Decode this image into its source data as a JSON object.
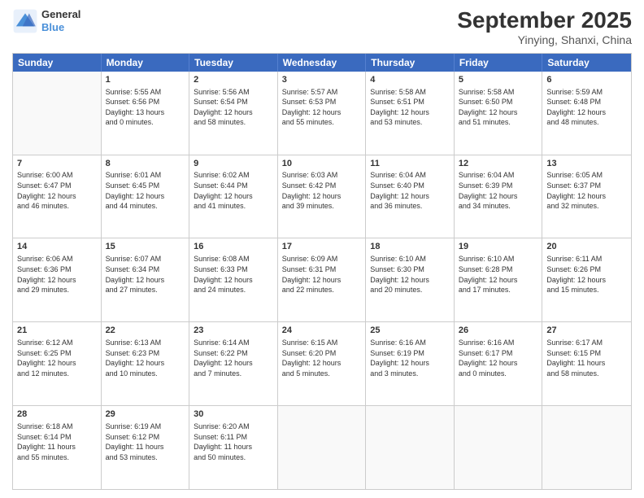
{
  "logo": {
    "line1": "General",
    "line2": "Blue"
  },
  "title": "September 2025",
  "location": "Yinying, Shanxi, China",
  "header_days": [
    "Sunday",
    "Monday",
    "Tuesday",
    "Wednesday",
    "Thursday",
    "Friday",
    "Saturday"
  ],
  "weeks": [
    [
      {
        "day": "",
        "info": ""
      },
      {
        "day": "1",
        "info": "Sunrise: 5:55 AM\nSunset: 6:56 PM\nDaylight: 13 hours\nand 0 minutes."
      },
      {
        "day": "2",
        "info": "Sunrise: 5:56 AM\nSunset: 6:54 PM\nDaylight: 12 hours\nand 58 minutes."
      },
      {
        "day": "3",
        "info": "Sunrise: 5:57 AM\nSunset: 6:53 PM\nDaylight: 12 hours\nand 55 minutes."
      },
      {
        "day": "4",
        "info": "Sunrise: 5:58 AM\nSunset: 6:51 PM\nDaylight: 12 hours\nand 53 minutes."
      },
      {
        "day": "5",
        "info": "Sunrise: 5:58 AM\nSunset: 6:50 PM\nDaylight: 12 hours\nand 51 minutes."
      },
      {
        "day": "6",
        "info": "Sunrise: 5:59 AM\nSunset: 6:48 PM\nDaylight: 12 hours\nand 48 minutes."
      }
    ],
    [
      {
        "day": "7",
        "info": "Sunrise: 6:00 AM\nSunset: 6:47 PM\nDaylight: 12 hours\nand 46 minutes."
      },
      {
        "day": "8",
        "info": "Sunrise: 6:01 AM\nSunset: 6:45 PM\nDaylight: 12 hours\nand 44 minutes."
      },
      {
        "day": "9",
        "info": "Sunrise: 6:02 AM\nSunset: 6:44 PM\nDaylight: 12 hours\nand 41 minutes."
      },
      {
        "day": "10",
        "info": "Sunrise: 6:03 AM\nSunset: 6:42 PM\nDaylight: 12 hours\nand 39 minutes."
      },
      {
        "day": "11",
        "info": "Sunrise: 6:04 AM\nSunset: 6:40 PM\nDaylight: 12 hours\nand 36 minutes."
      },
      {
        "day": "12",
        "info": "Sunrise: 6:04 AM\nSunset: 6:39 PM\nDaylight: 12 hours\nand 34 minutes."
      },
      {
        "day": "13",
        "info": "Sunrise: 6:05 AM\nSunset: 6:37 PM\nDaylight: 12 hours\nand 32 minutes."
      }
    ],
    [
      {
        "day": "14",
        "info": "Sunrise: 6:06 AM\nSunset: 6:36 PM\nDaylight: 12 hours\nand 29 minutes."
      },
      {
        "day": "15",
        "info": "Sunrise: 6:07 AM\nSunset: 6:34 PM\nDaylight: 12 hours\nand 27 minutes."
      },
      {
        "day": "16",
        "info": "Sunrise: 6:08 AM\nSunset: 6:33 PM\nDaylight: 12 hours\nand 24 minutes."
      },
      {
        "day": "17",
        "info": "Sunrise: 6:09 AM\nSunset: 6:31 PM\nDaylight: 12 hours\nand 22 minutes."
      },
      {
        "day": "18",
        "info": "Sunrise: 6:10 AM\nSunset: 6:30 PM\nDaylight: 12 hours\nand 20 minutes."
      },
      {
        "day": "19",
        "info": "Sunrise: 6:10 AM\nSunset: 6:28 PM\nDaylight: 12 hours\nand 17 minutes."
      },
      {
        "day": "20",
        "info": "Sunrise: 6:11 AM\nSunset: 6:26 PM\nDaylight: 12 hours\nand 15 minutes."
      }
    ],
    [
      {
        "day": "21",
        "info": "Sunrise: 6:12 AM\nSunset: 6:25 PM\nDaylight: 12 hours\nand 12 minutes."
      },
      {
        "day": "22",
        "info": "Sunrise: 6:13 AM\nSunset: 6:23 PM\nDaylight: 12 hours\nand 10 minutes."
      },
      {
        "day": "23",
        "info": "Sunrise: 6:14 AM\nSunset: 6:22 PM\nDaylight: 12 hours\nand 7 minutes."
      },
      {
        "day": "24",
        "info": "Sunrise: 6:15 AM\nSunset: 6:20 PM\nDaylight: 12 hours\nand 5 minutes."
      },
      {
        "day": "25",
        "info": "Sunrise: 6:16 AM\nSunset: 6:19 PM\nDaylight: 12 hours\nand 3 minutes."
      },
      {
        "day": "26",
        "info": "Sunrise: 6:16 AM\nSunset: 6:17 PM\nDaylight: 12 hours\nand 0 minutes."
      },
      {
        "day": "27",
        "info": "Sunrise: 6:17 AM\nSunset: 6:15 PM\nDaylight: 11 hours\nand 58 minutes."
      }
    ],
    [
      {
        "day": "28",
        "info": "Sunrise: 6:18 AM\nSunset: 6:14 PM\nDaylight: 11 hours\nand 55 minutes."
      },
      {
        "day": "29",
        "info": "Sunrise: 6:19 AM\nSunset: 6:12 PM\nDaylight: 11 hours\nand 53 minutes."
      },
      {
        "day": "30",
        "info": "Sunrise: 6:20 AM\nSunset: 6:11 PM\nDaylight: 11 hours\nand 50 minutes."
      },
      {
        "day": "",
        "info": ""
      },
      {
        "day": "",
        "info": ""
      },
      {
        "day": "",
        "info": ""
      },
      {
        "day": "",
        "info": ""
      }
    ]
  ]
}
